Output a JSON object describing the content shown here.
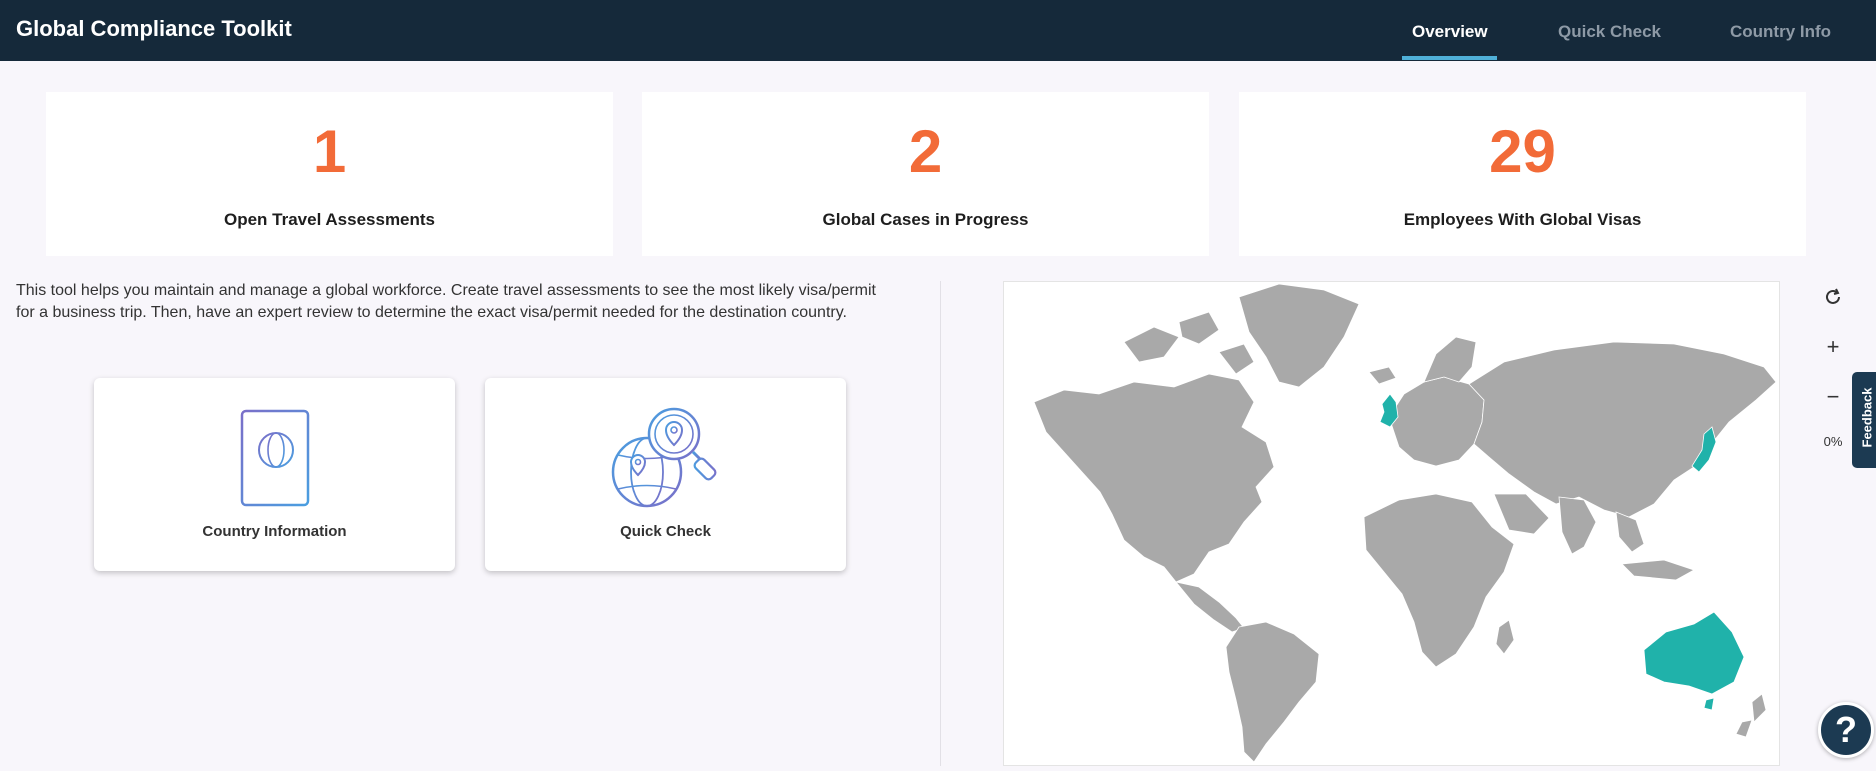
{
  "app": {
    "title": "Global Compliance Toolkit"
  },
  "nav": {
    "tabs": [
      {
        "label": "Overview",
        "active": true
      },
      {
        "label": "Quick Check",
        "active": false
      },
      {
        "label": "Country Info",
        "active": false
      }
    ]
  },
  "stats": [
    {
      "value": "1",
      "label": "Open Travel Assessments"
    },
    {
      "value": "2",
      "label": "Global Cases in Progress"
    },
    {
      "value": "29",
      "label": "Employees With Global Visas"
    }
  ],
  "intro": {
    "text": "This tool helps you maintain and manage a global workforce. Create travel assessments to see the most likely visa/permit for a business trip. Then, have an expert review to determine the exact visa/permit needed for the destination country."
  },
  "tools": [
    {
      "label": "Country Information",
      "icon": "passport-icon"
    },
    {
      "label": "Quick Check",
      "icon": "globe-search-icon"
    }
  ],
  "map": {
    "land_color": "#a9a9a9",
    "highlight_color": "#20b2aa",
    "highlighted_regions": [
      "United Kingdom",
      "Japan",
      "Australia"
    ],
    "controls": {
      "reset": "refresh-icon",
      "zoom_in": "+",
      "zoom_out": "−",
      "zoom_level": "0%"
    }
  },
  "feedback": {
    "label": "Feedback"
  },
  "help": {
    "label": "?"
  },
  "colors": {
    "header_bg": "#15293a",
    "accent": "#f26b38",
    "tab_underline": "#4fb0d8",
    "page_bg": "#f8f6fb"
  }
}
